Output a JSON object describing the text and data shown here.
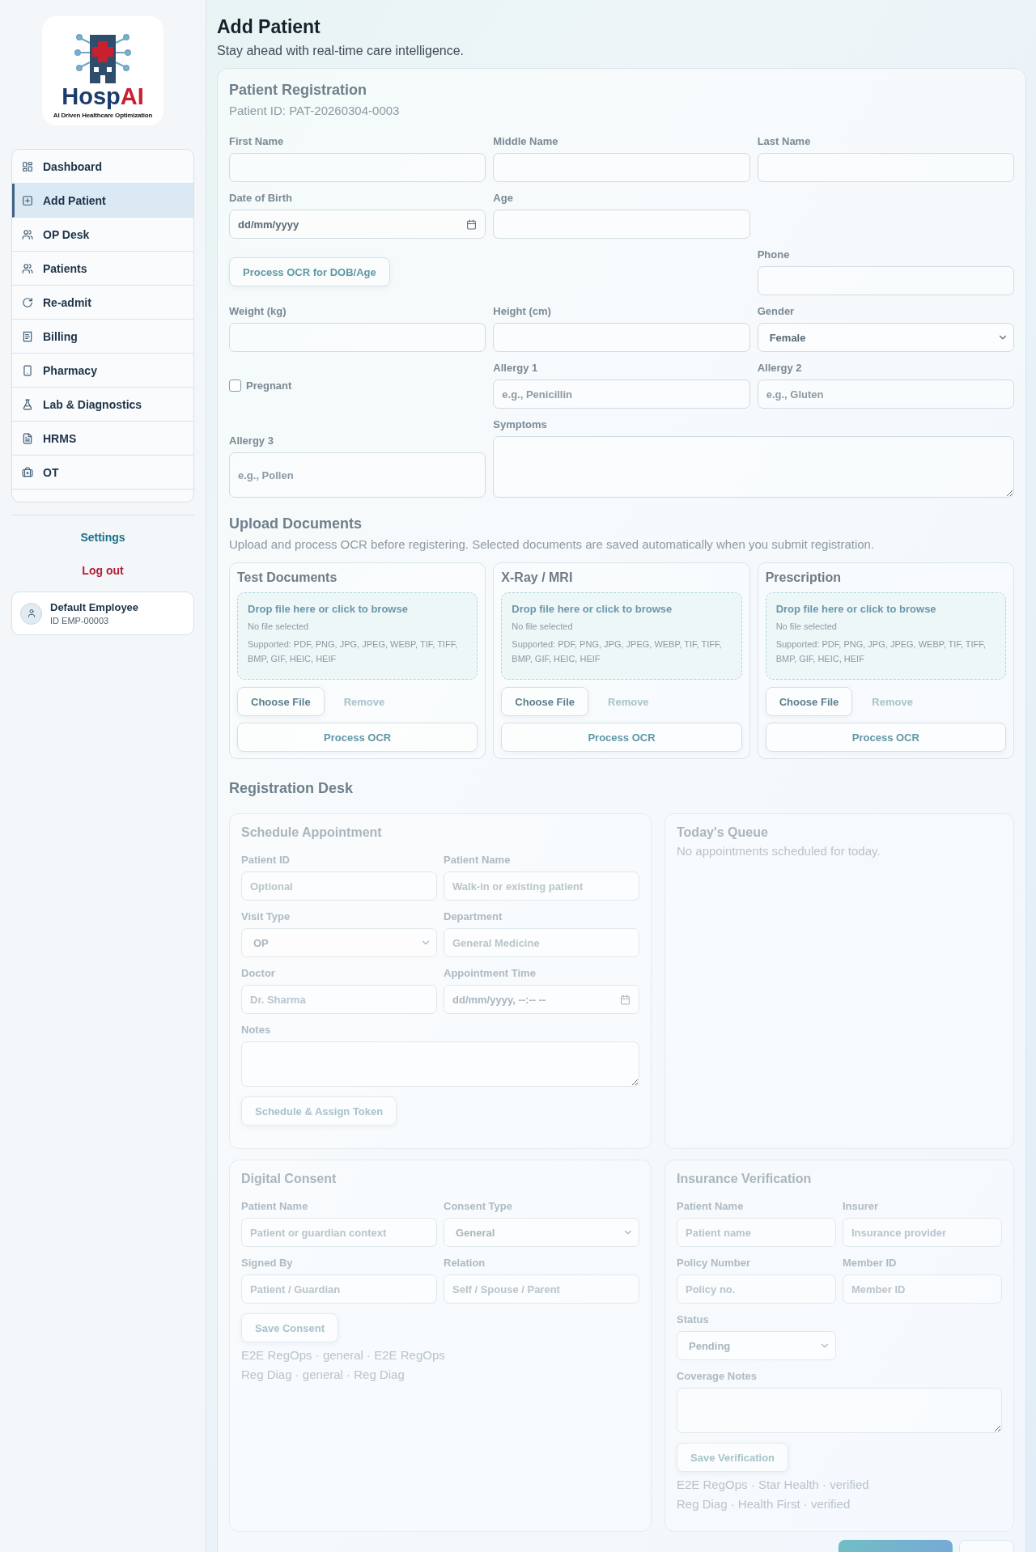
{
  "sidebar": {
    "logo": {
      "wordmark": [
        "Hosp",
        "AI"
      ],
      "tagline": "AI Driven Healthcare Optimization"
    },
    "nav": [
      {
        "label": "Dashboard",
        "selected": false
      },
      {
        "label": "Add Patient",
        "selected": true
      },
      {
        "label": "OP Desk",
        "selected": false
      },
      {
        "label": "Patients",
        "selected": false
      },
      {
        "label": "Re-admit",
        "selected": false
      },
      {
        "label": "Billing",
        "selected": false
      },
      {
        "label": "Pharmacy",
        "selected": false
      },
      {
        "label": "Lab & Diagnostics",
        "selected": false
      },
      {
        "label": "HRMS",
        "selected": false
      },
      {
        "label": "OT",
        "selected": false
      }
    ],
    "settings": "Settings",
    "logout": "Log out",
    "user": {
      "name": "Default Employee",
      "id": "ID EMP-00003"
    }
  },
  "header": {
    "title": "Add Patient",
    "subtitle": "Stay ahead with real-time care intelligence."
  },
  "registration": {
    "title": "Patient Registration",
    "patient_id": "Patient ID: PAT-20260304-0003",
    "rows": [
      [
        {
          "kind": "text",
          "label": "First Name"
        },
        {
          "kind": "text",
          "label": "Middle Name"
        },
        {
          "kind": "text",
          "label": "Last Name"
        }
      ],
      [
        {
          "kind": "date",
          "label": "Date of Birth",
          "value": "dd/mm/yyyy"
        },
        {
          "kind": "text",
          "label": "Age"
        },
        null
      ],
      [
        {
          "kind": "button",
          "text": "Process OCR for DOB/Age"
        },
        null,
        {
          "kind": "text",
          "label": "Phone"
        }
      ],
      [
        {
          "kind": "text",
          "label": "Weight (kg)"
        },
        {
          "kind": "text",
          "label": "Height (cm)"
        },
        {
          "kind": "select",
          "label": "Gender",
          "value": "Female"
        }
      ],
      [
        {
          "kind": "checkbox",
          "label": "Pregnant",
          "checked": false
        },
        {
          "kind": "text",
          "label": "Allergy 1",
          "placeholder": "e.g., Penicillin"
        },
        {
          "kind": "text",
          "label": "Allergy 2",
          "placeholder": "e.g., Gluten"
        }
      ],
      [
        {
          "kind": "tall",
          "label": "Allergy 3",
          "placeholder": "e.g., Pollen"
        },
        {
          "kind": "textarea",
          "label": "Symptoms"
        }
      ]
    ]
  },
  "upload": {
    "title": "Upload Documents",
    "description": "Upload and process OCR before registering. Selected documents are saved automatically when you submit registration.",
    "cards": [
      {
        "title": "Test Documents",
        "drop": "Drop file here or click to browse",
        "status": "No file selected",
        "supported": "Supported: PDF, PNG, JPG, JPEG, WEBP, TIF, TIFF, BMP, GIF, HEIC, HEIF",
        "choose": "Choose File",
        "remove": {
          "text": "Remove",
          "disabled": true
        },
        "process": "Process OCR"
      },
      {
        "title": "X-Ray / MRI",
        "drop": "Drop file here or click to browse",
        "status": "No file selected",
        "supported": "Supported: PDF, PNG, JPG, JPEG, WEBP, TIF, TIFF, BMP, GIF, HEIC, HEIF",
        "choose": "Choose File",
        "remove": {
          "text": "Remove",
          "disabled": true
        },
        "process": "Process OCR"
      },
      {
        "title": "Prescription",
        "drop": "Drop file here or click to browse",
        "status": "No file selected",
        "supported": "Supported: PDF, PNG, JPG, JPEG, WEBP, TIF, TIFF, BMP, GIF, HEIC, HEIF",
        "choose": "Choose File",
        "remove": {
          "text": "Remove",
          "disabled": true
        },
        "process": "Process OCR"
      }
    ]
  },
  "desk": {
    "title": "Registration Desk",
    "panels": [
      {
        "title": "Schedule Appointment",
        "fields": [
          {
            "kind": "text",
            "label": "Patient ID",
            "placeholder": "Optional"
          },
          {
            "kind": "text",
            "label": "Patient Name",
            "placeholder": "Walk-in or existing patient"
          },
          {
            "kind": "select",
            "label": "Visit Type",
            "value": "OP"
          },
          {
            "kind": "text",
            "label": "Department",
            "placeholder": "General Medicine"
          },
          {
            "kind": "text",
            "label": "Doctor",
            "placeholder": "Dr. Sharma"
          },
          {
            "kind": "date",
            "label": "Appointment Time",
            "value": "dd/mm/yyyy, --:-- --"
          },
          {
            "kind": "textarea",
            "label": "Notes"
          }
        ],
        "button": "Schedule & Assign Token"
      },
      {
        "title": "Today's Queue",
        "message": "No appointments scheduled for today."
      },
      {
        "title": "Digital Consent",
        "fields": [
          {
            "kind": "text",
            "label": "Patient Name",
            "placeholder": "Patient or guardian context"
          },
          {
            "kind": "select",
            "label": "Consent Type",
            "value": "General"
          },
          {
            "kind": "text",
            "label": "Signed By",
            "placeholder": "Patient / Guardian"
          },
          {
            "kind": "text",
            "label": "Relation",
            "placeholder": "Self / Spouse / Parent"
          }
        ],
        "button": "Save Consent",
        "entries": [
          "E2E RegOps · general · E2E RegOps",
          "Reg Diag · general · Reg Diag"
        ]
      },
      {
        "title": "Insurance Verification",
        "fields": [
          {
            "kind": "text",
            "label": "Patient Name",
            "placeholder": "Patient name"
          },
          {
            "kind": "text",
            "label": "Insurer",
            "placeholder": "Insurance provider"
          },
          {
            "kind": "text",
            "label": "Policy Number",
            "placeholder": "Policy no."
          },
          {
            "kind": "text",
            "label": "Member ID",
            "placeholder": "Member ID"
          },
          {
            "kind": "select",
            "label": "Status",
            "value": "Pending"
          },
          {
            "kind": "spacer"
          },
          {
            "kind": "textarea",
            "label": "Coverage Notes"
          }
        ],
        "button": "Save Verification",
        "entries": [
          "E2E RegOps · Star Health · verified",
          "Reg Diag · Health First · verified"
        ]
      }
    ]
  }
}
